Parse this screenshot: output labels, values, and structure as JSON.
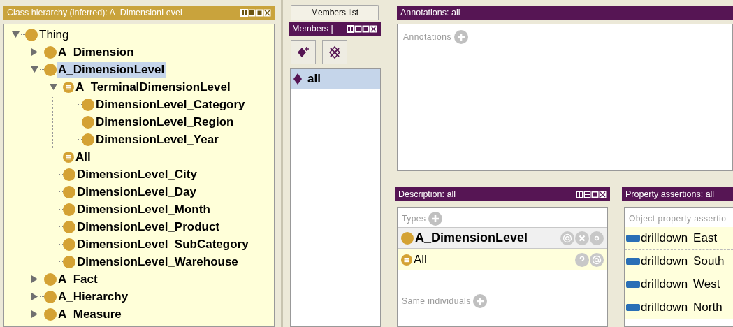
{
  "class_hierarchy": {
    "title": "Class hierarchy (inferred): A_DimensionLevel",
    "tree": [
      {
        "label": "Thing",
        "kind": "class",
        "expanded": true,
        "selected": false,
        "children": [
          {
            "label": "A_Dimension",
            "kind": "class",
            "expanded": false,
            "selected": false
          },
          {
            "label": "A_DimensionLevel",
            "kind": "class",
            "expanded": true,
            "selected": true,
            "children": [
              {
                "label": "A_TerminalDimensionLevel",
                "kind": "defined",
                "expanded": true,
                "selected": false,
                "children": [
                  {
                    "label": "DimensionLevel_Category",
                    "kind": "class",
                    "selected": false
                  },
                  {
                    "label": "DimensionLevel_Region",
                    "kind": "class",
                    "selected": false
                  },
                  {
                    "label": "DimensionLevel_Year",
                    "kind": "class",
                    "selected": false
                  }
                ]
              },
              {
                "label": "All",
                "kind": "defined",
                "selected": false
              },
              {
                "label": "DimensionLevel_City",
                "kind": "class",
                "selected": false
              },
              {
                "label": "DimensionLevel_Day",
                "kind": "class",
                "selected": false
              },
              {
                "label": "DimensionLevel_Month",
                "kind": "class",
                "selected": false
              },
              {
                "label": "DimensionLevel_Product",
                "kind": "class",
                "selected": false
              },
              {
                "label": "DimensionLevel_SubCategory",
                "kind": "class",
                "selected": false
              },
              {
                "label": "DimensionLevel_Warehouse",
                "kind": "class",
                "selected": false
              }
            ]
          },
          {
            "label": "A_Fact",
            "kind": "class",
            "expanded": false,
            "selected": false
          },
          {
            "label": "A_Hierarchy",
            "kind": "class",
            "expanded": false,
            "selected": false
          },
          {
            "label": "A_Measure",
            "kind": "class",
            "expanded": false,
            "selected": false
          }
        ]
      }
    ]
  },
  "members": {
    "tab": "Members list",
    "title": "Members |",
    "items": [
      {
        "label": "all",
        "selected": true
      }
    ]
  },
  "annotations": {
    "title": "Annotations: all",
    "section": "Annotations"
  },
  "description": {
    "title": "Description: all",
    "types_label": "Types",
    "types": [
      {
        "label": "A_DimensionLevel",
        "kind": "asserted"
      },
      {
        "label": "All",
        "kind": "inferred"
      }
    ],
    "same_individuals_label": "Same individuals"
  },
  "property_assertions": {
    "title": "Property assertions: all",
    "section": "Object property assertio",
    "rows": [
      {
        "property": "drilldown",
        "value": "East"
      },
      {
        "property": "drilldown",
        "value": "South"
      },
      {
        "property": "drilldown",
        "value": "West"
      },
      {
        "property": "drilldown",
        "value": "North"
      }
    ]
  }
}
